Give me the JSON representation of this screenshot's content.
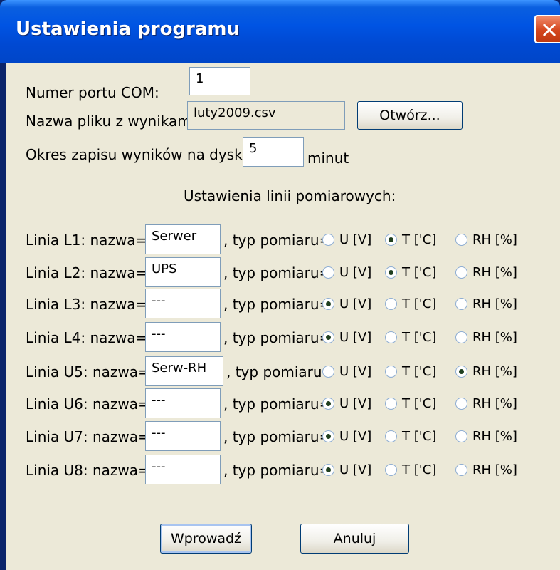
{
  "window": {
    "title": "Ustawienia programu"
  },
  "com_port": {
    "label": "Numer portu COM:",
    "value": "1"
  },
  "file": {
    "label": "Nazwa pliku z wynikami:",
    "value": "luty2009.csv",
    "open_button": "Otwórz..."
  },
  "save_period": {
    "label": "Okres zapisu wyników na dysk:",
    "value": "5",
    "unit": "minut"
  },
  "lines_section": {
    "title": "Ustawienia linii pomiarowych:"
  },
  "type_label": ", typ pomiaru=",
  "options": [
    "U [V]",
    "T ['C]",
    "RH [%]"
  ],
  "lines": [
    {
      "label": "Linia L1: nazwa=",
      "name": "Serwer",
      "selected": "T ['C]"
    },
    {
      "label": "Linia L2: nazwa=",
      "name": "UPS",
      "selected": "T ['C]"
    },
    {
      "label": "Linia L3: nazwa=",
      "name": "---",
      "selected": "U [V]"
    },
    {
      "label": "Linia L4: nazwa=",
      "name": "---",
      "selected": "U [V]"
    },
    {
      "label": "Linia U5: nazwa=",
      "name": "Serw-RH",
      "selected": "RH [%]"
    },
    {
      "label": "Linia U6: nazwa=",
      "name": "---",
      "selected": "U [V]"
    },
    {
      "label": "Linia U7: nazwa=",
      "name": "---",
      "selected": "U [V]"
    },
    {
      "label": "Linia U8: nazwa=",
      "name": "---",
      "selected": "U [V]"
    }
  ],
  "buttons": {
    "ok": "Wprowadź",
    "cancel": "Anuluj"
  }
}
